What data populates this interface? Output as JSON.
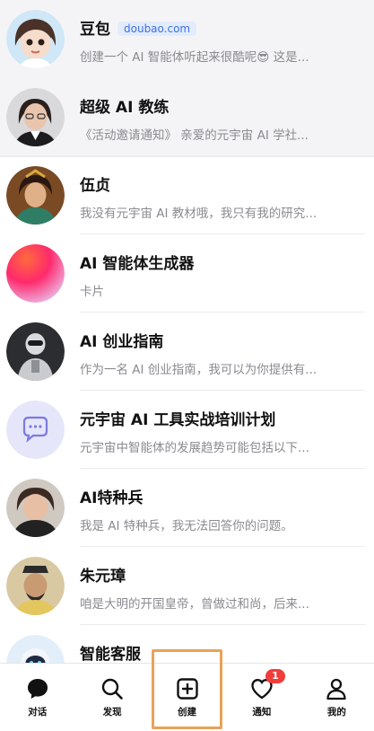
{
  "chats": [
    {
      "name": "豆包",
      "badge": "doubao.com",
      "preview": "创建一个 AI 智能体听起来很酷呢😎 这是..."
    },
    {
      "name": "超级 AI 教练",
      "preview": "《活动邀请通知》 亲爱的元宇宙 AI 学社..."
    },
    {
      "name": "伍贞",
      "preview": "我没有元宇宙 AI 教材哦，我只有我的研究..."
    },
    {
      "name": "AI 智能体生成器",
      "preview": "卡片"
    },
    {
      "name": "AI 创业指南",
      "preview": "作为一名 AI 创业指南，我可以为你提供有..."
    },
    {
      "name": "元宇宙 AI 工具实战培训计划",
      "preview": "元宇宙中智能体的发展趋势可能包括以下..."
    },
    {
      "name": "AI特种兵",
      "preview": "我是 AI 特种兵，我无法回答你的问题。"
    },
    {
      "name": "朱元璋",
      "preview": "咱是大明的开国皇帝，曾做过和尚，后来..."
    },
    {
      "name": "智能客服",
      "preview": ""
    }
  ],
  "tabs": [
    {
      "label": "对话",
      "icon": "chat-bubble-icon"
    },
    {
      "label": "发现",
      "icon": "search-icon"
    },
    {
      "label": "创建",
      "icon": "plus-square-icon"
    },
    {
      "label": "通知",
      "icon": "heart-icon",
      "badge": "1"
    },
    {
      "label": "我的",
      "icon": "person-icon"
    }
  ],
  "colors": {
    "highlight": "#e8a257",
    "badge_red": "#f23d3d",
    "link_blue": "#3d6fe6"
  }
}
